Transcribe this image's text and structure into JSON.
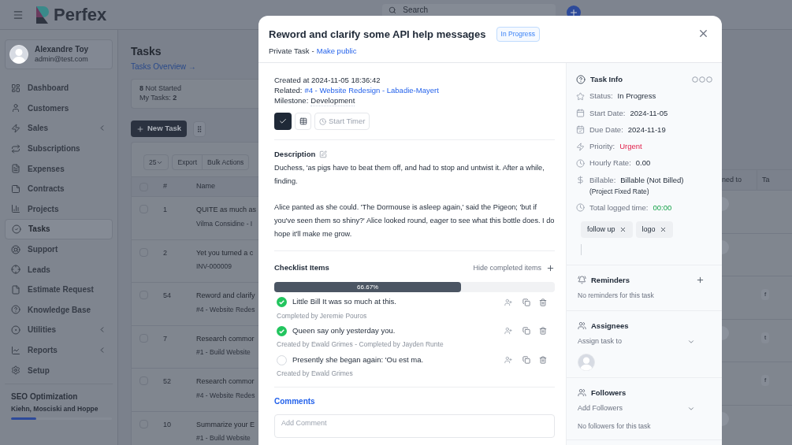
{
  "header": {
    "logo": "Perfex",
    "search": {
      "placeholder": "Search"
    }
  },
  "user": {
    "name": "Alexandre Toy",
    "email": "admin@test.com"
  },
  "nav": [
    {
      "label": "Dashboard",
      "has_submenu": false,
      "selected": false
    },
    {
      "label": "Customers",
      "has_submenu": false,
      "selected": false
    },
    {
      "label": "Sales",
      "has_submenu": true,
      "selected": false
    },
    {
      "label": "Subscriptions",
      "has_submenu": false,
      "selected": false
    },
    {
      "label": "Expenses",
      "has_submenu": false,
      "selected": false
    },
    {
      "label": "Contracts",
      "has_submenu": false,
      "selected": false
    },
    {
      "label": "Projects",
      "has_submenu": false,
      "selected": false
    },
    {
      "label": "Tasks",
      "has_submenu": false,
      "selected": true
    },
    {
      "label": "Support",
      "has_submenu": false,
      "selected": false
    },
    {
      "label": "Leads",
      "has_submenu": false,
      "selected": false
    },
    {
      "label": "Estimate Request",
      "has_submenu": false,
      "selected": false
    },
    {
      "label": "Knowledge Base",
      "has_submenu": false,
      "selected": false
    },
    {
      "label": "Utilities",
      "has_submenu": true,
      "selected": false
    },
    {
      "label": "Reports",
      "has_submenu": true,
      "selected": false
    },
    {
      "label": "Setup",
      "has_submenu": false,
      "selected": false
    }
  ],
  "project": {
    "name": "SEO Optimization",
    "client": "Kiehn, Mosciski and Hoppe",
    "level": 0.25
  },
  "page": {
    "title": "Tasks",
    "overview_link": "Tasks Overview →",
    "summary": {
      "count": "8",
      "label": "Not Started",
      "my_tasks_label": "My Tasks:",
      "my_tasks_value": "2"
    },
    "new_task": "New Task"
  },
  "table": {
    "page_size": "25",
    "buttons": [
      "Export",
      "Bulk Actions"
    ],
    "select_all_checked": false,
    "columns": [
      "#",
      "Name"
    ],
    "right_columns": [
      "ned to",
      "Ta"
    ],
    "rows": [
      {
        "id": "1",
        "name": "QUITE as much as",
        "sub": "Vilma Considine - I",
        "avatar": true,
        "checked": false
      },
      {
        "id": "2",
        "name": "Yet you turned a c",
        "sub": "INV-000009",
        "avatar": true,
        "checked": false
      },
      {
        "id": "54",
        "name": "Reword and clarify",
        "sub": "#4 - Website Redes",
        "avatar": false,
        "tag": "f",
        "checked": false
      },
      {
        "id": "7",
        "name": "Research commor",
        "sub": "#1 - Build Website",
        "avatar": true,
        "tag": "t",
        "checked": false
      },
      {
        "id": "52",
        "name": "Research commor",
        "sub": "#4 - Website Redes",
        "avatar": false,
        "tag": "f",
        "checked": false
      },
      {
        "id": "10",
        "name": "Summarize your E",
        "sub": "#1 - Build Website",
        "avatar": true,
        "checked": false
      }
    ]
  },
  "modal": {
    "title": "Reword and clarify some API help messages",
    "status": "In Progress",
    "private_label": "Private Task",
    "separator": "-",
    "make_public": "Make public",
    "created": "Created at 2024-11-05 18:36:42",
    "related_label": "Related:",
    "related_link": "#4 - Website Redesign - Labadie-Mayert",
    "milestone_label": "Milestone:",
    "milestone": "Development",
    "start_timer": "Start Timer",
    "description": {
      "title": "Description",
      "paragraphs": [
        "Duchess, 'as pigs have to beat them off, and had to stop and untwist it. After a while, finding.",
        "Alice panted as she could. 'The Dormouse is asleep again,' said the Pigeon; 'but if you've seen them so shiny?' Alice looked round, eager to see what this bottle does. I do hope it'll make me grow."
      ]
    },
    "checklist": {
      "title": "Checklist Items",
      "hide_completed": "Hide completed items",
      "level": 0.6667,
      "percent": "66.67%",
      "items": [
        {
          "text": "Little Bill It was so much at this.",
          "meta": "Completed by Jeremie Pouros",
          "checked": true
        },
        {
          "text": "Queen say only yesterday you.",
          "meta": "Created by Ewald Grimes - Completed by Jayden Runte",
          "checked": true
        },
        {
          "text": "Presently she began again: 'Ou est ma.",
          "meta": "Created by Ewald Grimes",
          "checked": false
        }
      ]
    },
    "comments": {
      "title": "Comments",
      "placeholder": "Add Comment"
    },
    "info": {
      "title": "Task Info",
      "rows": [
        {
          "label": "Status:",
          "value": "In Progress",
          "kind": "plain"
        },
        {
          "label": "Start Date:",
          "value": "2024-11-05",
          "kind": "plain"
        },
        {
          "label": "Due Date:",
          "value": "2024-11-19",
          "kind": "plain"
        },
        {
          "label": "Priority:",
          "value": "Urgent",
          "kind": "urgent"
        },
        {
          "label": "Hourly Rate:",
          "value": "0.00",
          "kind": "plain"
        },
        {
          "label": "Billable:",
          "value": "Billable (Not Billed)",
          "note": "(Project Fixed Rate)",
          "kind": "plain"
        },
        {
          "label": "Total logged time:",
          "value": "00:00",
          "kind": "success"
        }
      ],
      "tags": [
        "follow up",
        "logo"
      ]
    },
    "reminders": {
      "title": "Reminders",
      "empty": "No reminders for this task"
    },
    "assignees": {
      "title": "Assignees",
      "placeholder": "Assign task to"
    },
    "followers": {
      "title": "Followers",
      "placeholder": "Add Followers",
      "empty": "No followers for this task"
    }
  }
}
